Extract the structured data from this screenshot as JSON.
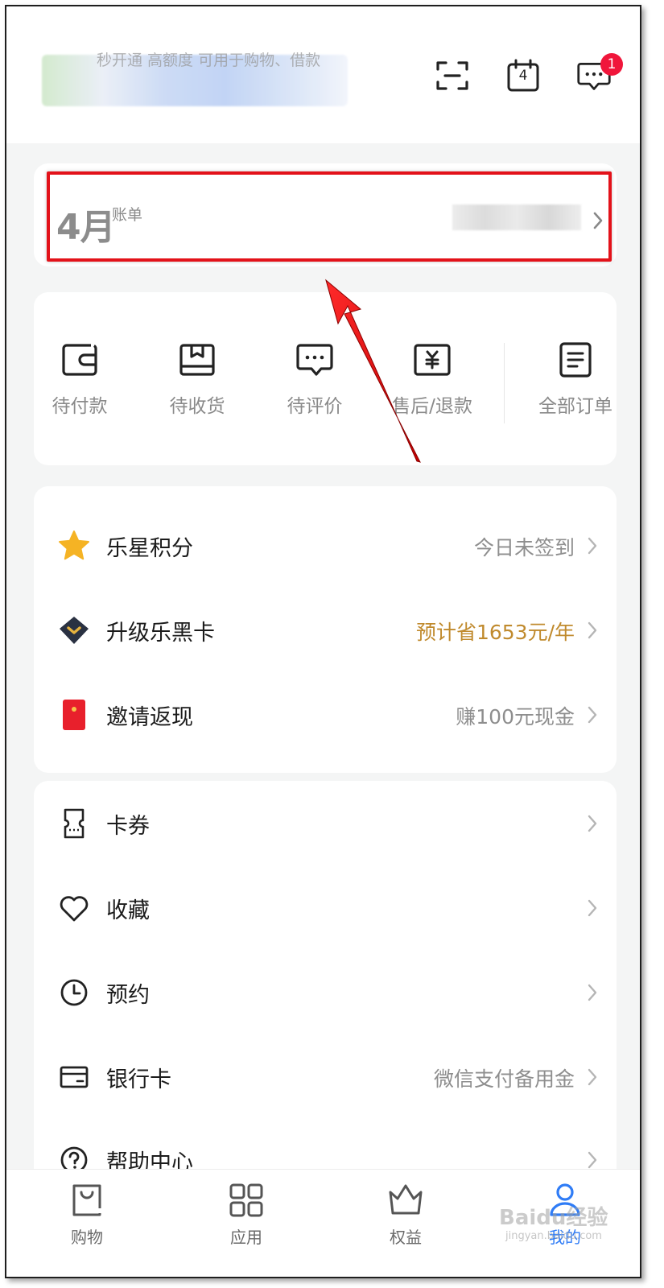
{
  "header": {
    "user_subtitle": "秒开通 高额度 可用于购物、借款",
    "calendar_day": "4",
    "message_badge": "1"
  },
  "bill": {
    "month": "4月",
    "label": "账单"
  },
  "orders": [
    {
      "label": "待付款",
      "icon": "wallet-icon"
    },
    {
      "label": "待收货",
      "icon": "box-icon"
    },
    {
      "label": "待评价",
      "icon": "comment-icon"
    },
    {
      "label": "售后/退款",
      "icon": "refund-icon"
    },
    {
      "label": "全部订单",
      "icon": "order-list-icon"
    }
  ],
  "benefits": [
    {
      "title": "乐星积分",
      "value": "今日未签到",
      "icon": "star-icon"
    },
    {
      "title": "升级乐黑卡",
      "value": "预计省1653元/年",
      "icon": "black-card-icon"
    },
    {
      "title": "邀请返现",
      "value": "赚100元现金",
      "icon": "red-envelope-icon"
    }
  ],
  "list": [
    {
      "title": "卡券",
      "value": "",
      "icon": "coupon-icon"
    },
    {
      "title": "收藏",
      "value": "",
      "icon": "heart-icon"
    },
    {
      "title": "预约",
      "value": "",
      "icon": "clock-icon"
    },
    {
      "title": "银行卡",
      "value": "微信支付备用金",
      "icon": "bank-card-icon"
    },
    {
      "title": "帮助中心",
      "value": "",
      "icon": "help-icon"
    }
  ],
  "tabs": [
    {
      "label": "购物",
      "icon": "shopping-bag-icon"
    },
    {
      "label": "应用",
      "icon": "apps-grid-icon"
    },
    {
      "label": "权益",
      "icon": "crown-icon"
    },
    {
      "label": "我的",
      "icon": "profile-icon"
    }
  ],
  "watermark": {
    "brand": "Baidu经验",
    "url": "jingyan.baidu.com"
  },
  "colors": {
    "highlight_red": "#e3121a",
    "active_tab": "#2f7cf6",
    "gold_text": "#c08a2d",
    "badge_red": "#f0163b",
    "star_yellow": "#f5b324"
  }
}
